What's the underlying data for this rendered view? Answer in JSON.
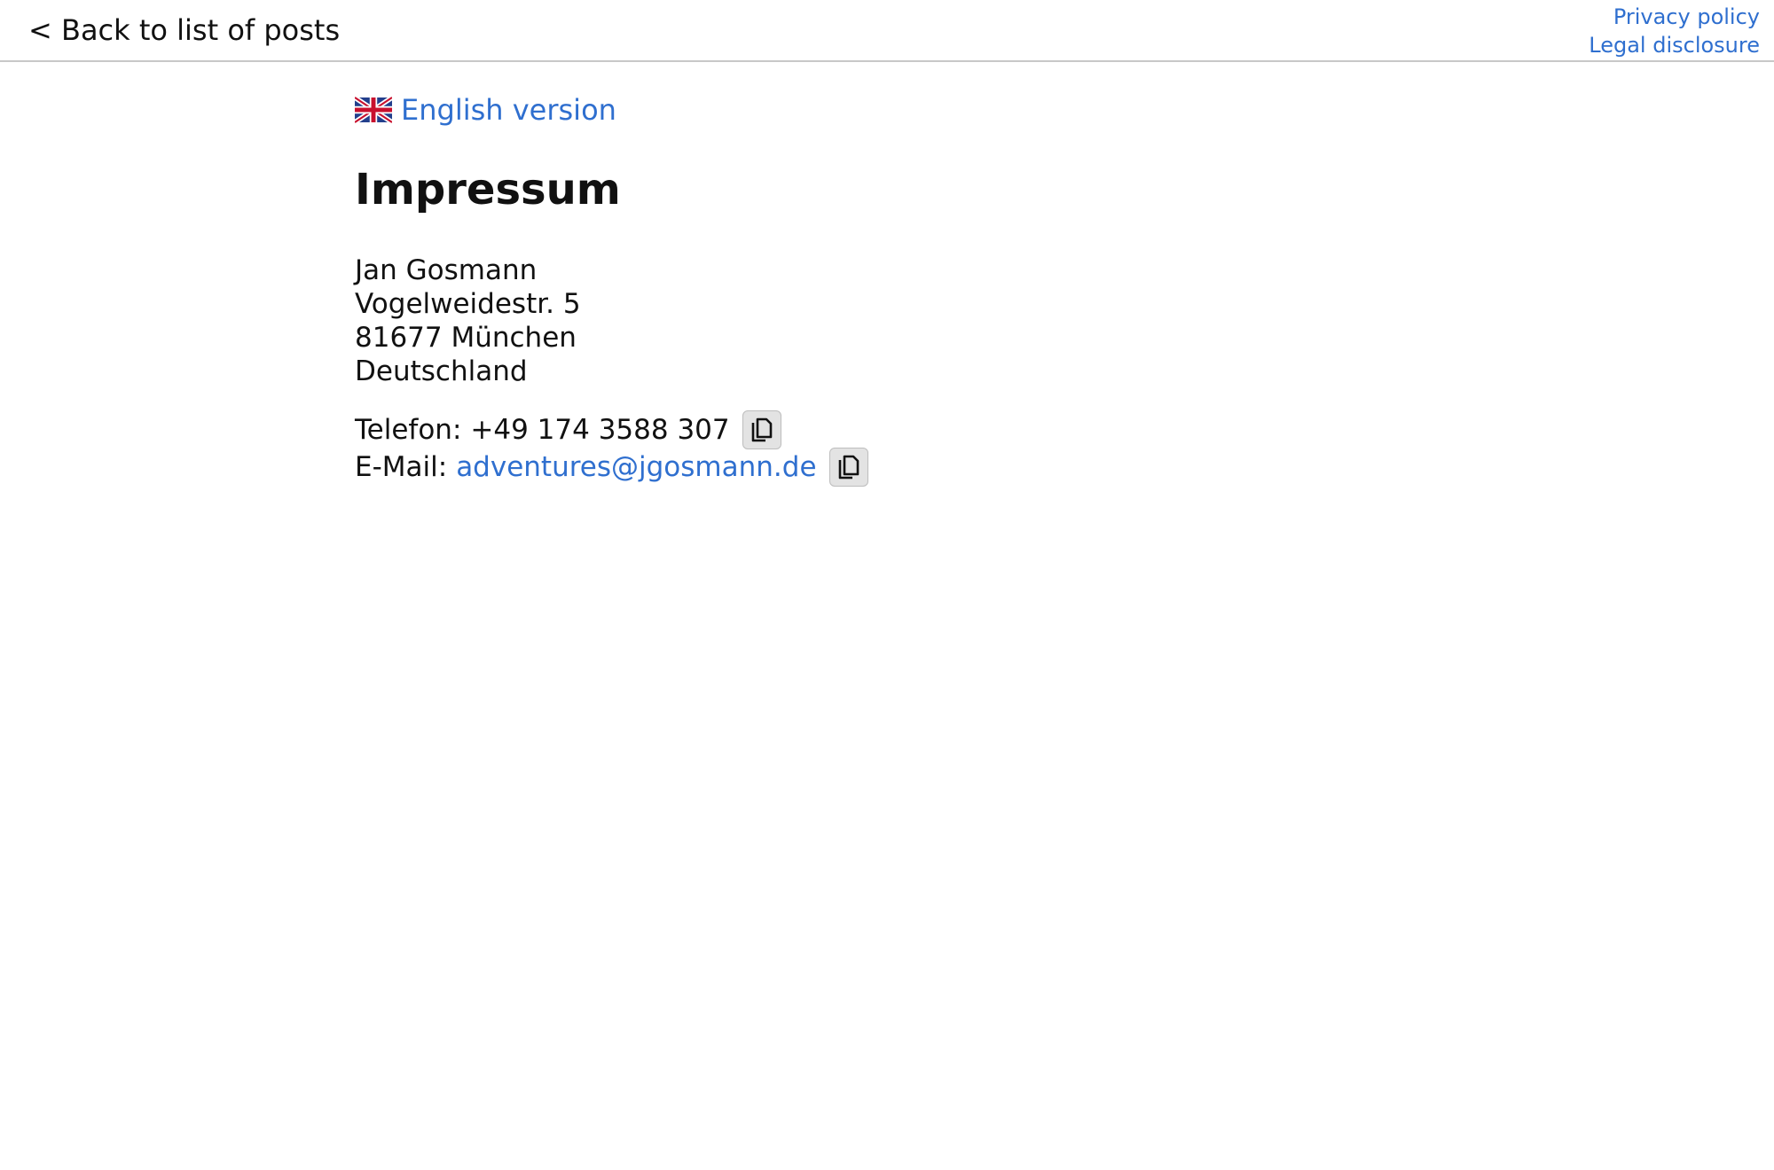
{
  "nav": {
    "back_label": "< Back to list of posts",
    "privacy_label": "Privacy policy",
    "legal_label": "Legal disclosure"
  },
  "lang_switch": {
    "label": "English version",
    "icon": "uk-flag-icon"
  },
  "title": "Impressum",
  "address": {
    "name": "Jan Gosmann",
    "street": "Vogelweidestr. 5",
    "city": "81677 München",
    "country": "Deutschland"
  },
  "contact": {
    "phone_label": "Telefon:",
    "phone_value": "+49 174 3588 307",
    "email_label": "E-Mail:",
    "email_value": "adventures@jgosmann.de",
    "copy_icon": "copy-icon"
  },
  "colors": {
    "link": "#2f6fcf",
    "text": "#111111",
    "divider": "#c8c8c8",
    "button_bg": "#e3e3e3"
  }
}
